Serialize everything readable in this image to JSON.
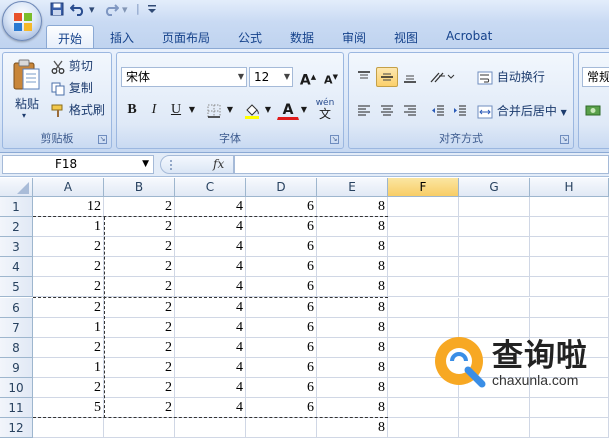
{
  "quick_access": {
    "dropdown": "▾",
    "separator": "|"
  },
  "tabs": [
    {
      "label": "开始",
      "active": true
    },
    {
      "label": "插入"
    },
    {
      "label": "页面布局"
    },
    {
      "label": "公式"
    },
    {
      "label": "数据"
    },
    {
      "label": "审阅"
    },
    {
      "label": "视图"
    },
    {
      "label": "Acrobat"
    }
  ],
  "ribbon": {
    "clipboard": {
      "paste": "粘贴",
      "cut": "剪切",
      "copy": "复制",
      "format_painter": "格式刷",
      "group_label": "剪贴板"
    },
    "font": {
      "font_name": "宋体",
      "font_size": "12",
      "grow": "A",
      "shrink": "A",
      "bold": "B",
      "italic": "I",
      "underline": "U",
      "font_color": "A",
      "phonetic": "wén",
      "phonetic_char": "文",
      "group_label": "字体"
    },
    "alignment": {
      "wrap_text": "自动换行",
      "merge_center": "合并后居中",
      "group_label": "对齐方式"
    },
    "number": {
      "format": "常规"
    }
  },
  "formula_bar": {
    "name_box": "F18",
    "fx": "fx",
    "formula": ""
  },
  "sheet": {
    "columns": [
      "A",
      "B",
      "C",
      "D",
      "E",
      "F",
      "G",
      "H"
    ],
    "selected_column": "F",
    "rows": [
      {
        "n": "1",
        "cells": [
          "12",
          "2",
          "4",
          "6",
          "8"
        ]
      },
      {
        "n": "2",
        "cells": [
          "1",
          "2",
          "4",
          "6",
          "8"
        ]
      },
      {
        "n": "3",
        "cells": [
          "2",
          "2",
          "4",
          "6",
          "8"
        ]
      },
      {
        "n": "4",
        "cells": [
          "2",
          "2",
          "4",
          "6",
          "8"
        ]
      },
      {
        "n": "5",
        "cells": [
          "2",
          "2",
          "4",
          "6",
          "8"
        ]
      },
      {
        "n": "6",
        "cells": [
          "2",
          "2",
          "4",
          "6",
          "8"
        ]
      },
      {
        "n": "7",
        "cells": [
          "1",
          "2",
          "4",
          "6",
          "8"
        ]
      },
      {
        "n": "8",
        "cells": [
          "2",
          "2",
          "4",
          "6",
          "8"
        ]
      },
      {
        "n": "9",
        "cells": [
          "1",
          "2",
          "4",
          "6",
          "8"
        ]
      },
      {
        "n": "10",
        "cells": [
          "2",
          "2",
          "4",
          "6",
          "8"
        ]
      },
      {
        "n": "11",
        "cells": [
          "5",
          "2",
          "4",
          "6",
          "8"
        ]
      },
      {
        "n": "12",
        "cells": [
          "",
          "",
          "",
          "",
          "8"
        ]
      }
    ]
  },
  "watermark": {
    "text": "查询啦",
    "url": "chaxunla.com"
  },
  "colors": {
    "selected_header": "#f8cd66",
    "tab_text": "#15428b",
    "watermark_accent": "#f7a823",
    "watermark_blue": "#3a8ee6"
  }
}
